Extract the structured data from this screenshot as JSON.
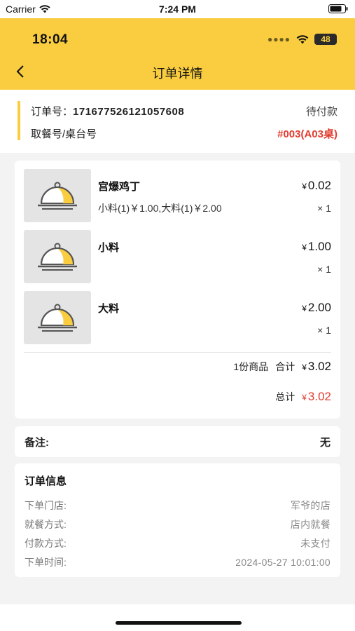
{
  "system_status": {
    "carrier": "Carrier",
    "time": "7:24 PM"
  },
  "inner_status": {
    "time": "18:04",
    "battery": "48"
  },
  "nav": {
    "title": "订单详情"
  },
  "order": {
    "no_label": "订单号：",
    "no_value": "171677526121057608",
    "status": "待付款",
    "table_label": "取餐号/桌台号",
    "table_value": "#003(A03桌)"
  },
  "items": [
    {
      "name": "宫爆鸡丁",
      "sub": "小料(1)￥1.00,大料(1)￥2.00",
      "currency": "¥",
      "price": "0.02",
      "qty": "× 1"
    },
    {
      "name": "小料",
      "sub": "",
      "currency": "¥",
      "price": "1.00",
      "qty": "× 1"
    },
    {
      "name": "大料",
      "sub": "",
      "currency": "¥",
      "price": "2.00",
      "qty": "× 1"
    }
  ],
  "summary": {
    "count_text": "1份商品",
    "subtotal_label": "合计",
    "subtotal_currency": "¥",
    "subtotal_value": "3.02",
    "total_label": "总计",
    "total_currency": "¥",
    "total_value": "3.02"
  },
  "remark": {
    "label": "备注:",
    "value": "无"
  },
  "info": {
    "title": "订单信息",
    "rows": [
      {
        "label": "下单门店:",
        "value": "军爷的店"
      },
      {
        "label": "就餐方式:",
        "value": "店内就餐"
      },
      {
        "label": "付款方式:",
        "value": "未支付"
      },
      {
        "label": "下单时间:",
        "value": "2024-05-27 10:01:00"
      }
    ]
  },
  "colors": {
    "accent": "#f9cd3f",
    "price_red": "#e23b2e"
  }
}
